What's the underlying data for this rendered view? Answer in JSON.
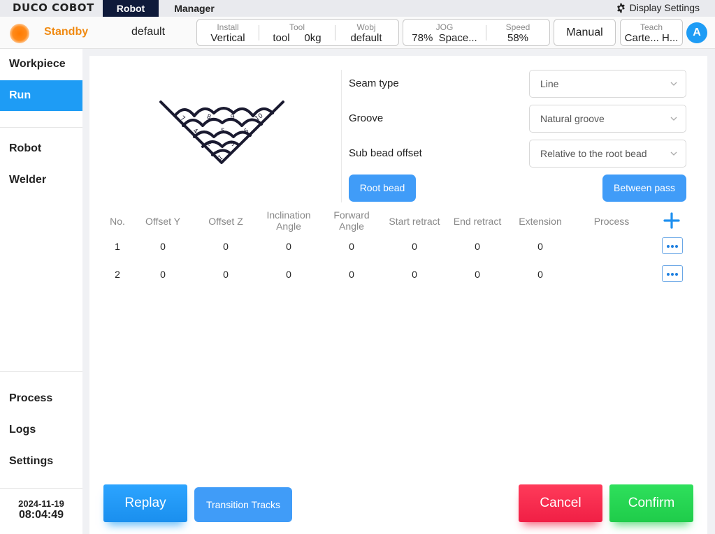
{
  "app": {
    "logo": "DUCO COBOT"
  },
  "tabs": [
    {
      "label": "Robot"
    },
    {
      "label": "Manager"
    }
  ],
  "display_settings": "Display Settings",
  "status": {
    "state": "Standby",
    "project": "default",
    "install": {
      "label": "Install",
      "value": "Vertical"
    },
    "tool": {
      "label": "Tool",
      "name": "tool",
      "load": "0kg"
    },
    "wobj": {
      "label": "Wobj",
      "value": "default"
    },
    "jog": {
      "label": "JOG",
      "percent": "78%",
      "value": "Space..."
    },
    "speed": {
      "label": "Speed",
      "value": "58%"
    },
    "mode": "Manual",
    "teach": {
      "label": "Teach",
      "value": "Carte...  H..."
    },
    "user_initial": "A"
  },
  "sidebar": {
    "items": [
      {
        "label": "Workpiece"
      },
      {
        "label": "Run"
      },
      {
        "label": "Robot"
      },
      {
        "label": "Welder"
      },
      {
        "label": "Process"
      },
      {
        "label": "Logs"
      },
      {
        "label": "Settings"
      }
    ],
    "date": "2024-11-19",
    "time": "08:04:49"
  },
  "diagram_labels": [
    "1",
    "2",
    "3",
    "4",
    "5",
    "6",
    "7",
    "8",
    "9",
    "10"
  ],
  "form": {
    "seam_type": {
      "label": "Seam type",
      "value": "Line"
    },
    "groove": {
      "label": "Groove",
      "value": "Natural groove"
    },
    "sub_bead_offset": {
      "label": "Sub bead offset",
      "value": "Relative to the root bead"
    },
    "root_bead_btn": "Root bead",
    "between_pass_btn": "Between pass"
  },
  "table": {
    "headers": [
      "No.",
      "Offset Y",
      "Offset Z",
      "Inclination Angle",
      "Forward Angle",
      "Start retract",
      "End retract",
      "Extension",
      "Process"
    ],
    "rows": [
      [
        "1",
        "0",
        "0",
        "0",
        "0",
        "0",
        "0",
        "0",
        ""
      ],
      [
        "2",
        "0",
        "0",
        "0",
        "0",
        "0",
        "0",
        "0",
        ""
      ]
    ]
  },
  "buttons": {
    "replay": "Replay",
    "transition_tracks": "Transition Tracks",
    "cancel": "Cancel",
    "confirm": "Confirm"
  },
  "colors": {
    "accent": "#1e9cf5",
    "standby": "#f08a12",
    "cancel": "#f01f45",
    "confirm": "#1fcc4a",
    "tab_active": "#0f1a3a"
  }
}
